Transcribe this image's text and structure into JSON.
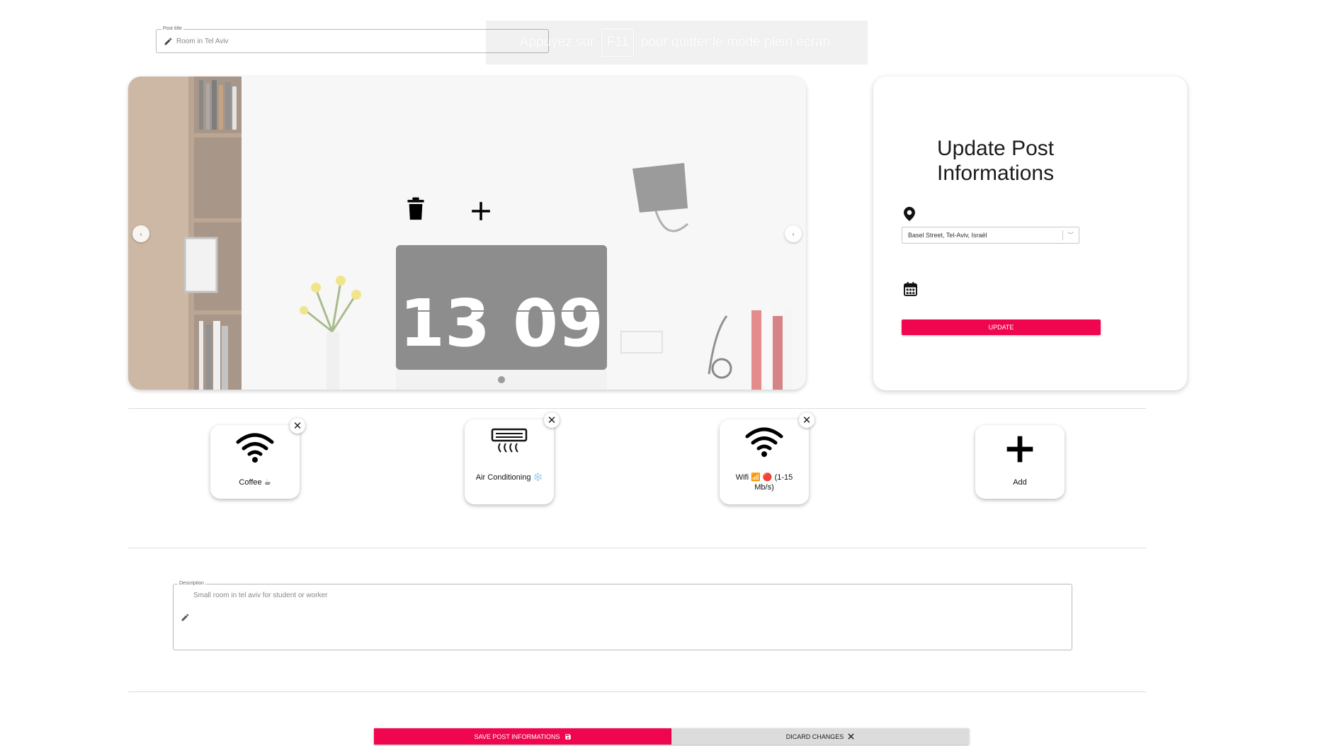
{
  "post_title": {
    "legend": "Post title",
    "value": "Room in Tel Aviv",
    "icon": "pencil-icon"
  },
  "fullscreen_toast": {
    "before": "Appuyez sur",
    "key": "F11",
    "after": "pour quitter le mode plein écran."
  },
  "carousel": {
    "photo_clock_hours": "13",
    "photo_clock_minutes": "09",
    "delete_icon": "trash-icon",
    "add_icon": "plus-icon",
    "prev_arrow": "‹",
    "next_arrow": "›"
  },
  "update_card": {
    "title": "Update Post Informations",
    "location_value": "Basel Street, Tel-Aviv, Israël",
    "location_chevron": "﹀",
    "button_label": "UPDATE",
    "accent": "#f0064f"
  },
  "amenities": [
    {
      "label": "Coffee ☕",
      "icon": "wifi-icon"
    },
    {
      "label": "Air Conditioning ❄️",
      "icon": "air-conditioner-icon"
    },
    {
      "label": "Wifi 📶 🔴 (1-15 Mb/s)",
      "icon": "wifi-icon"
    },
    {
      "label": "Add",
      "icon": "plus-icon"
    }
  ],
  "amenity_close_glyph": "✕",
  "description": {
    "legend": "Description",
    "value": "Small room in tel aviv for student or worker",
    "icon": "pencil-icon"
  },
  "actions": {
    "save_label": "SAVE POST INFORMATIONS",
    "save_icon": "save-icon",
    "discard_label": "DICARD CHANGES",
    "discard_icon": "close-icon",
    "save_color": "#f0064f",
    "discard_color": "#dcdcdc"
  }
}
